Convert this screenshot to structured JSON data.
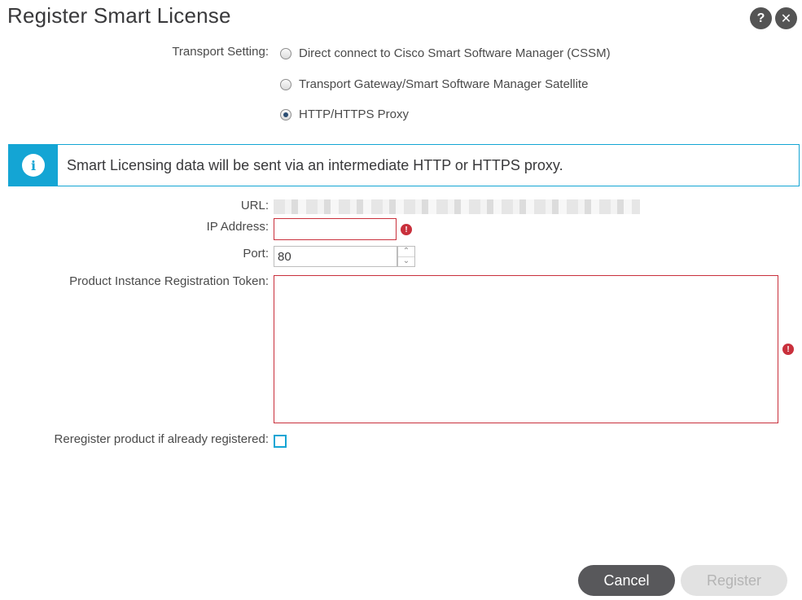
{
  "dialog": {
    "title": "Register Smart License",
    "help_label": "?",
    "close_label": "✕"
  },
  "transport": {
    "label": "Transport Setting:",
    "options": [
      {
        "label": "Direct connect to Cisco Smart Software Manager (CSSM)",
        "checked": false
      },
      {
        "label": "Transport Gateway/Smart Software Manager Satellite",
        "checked": false
      },
      {
        "label": "HTTP/HTTPS Proxy",
        "checked": true
      }
    ]
  },
  "info": {
    "icon": "info-icon",
    "glyph": "i",
    "message": "Smart Licensing data will be sent via an intermediate HTTP or HTTPS proxy."
  },
  "form": {
    "url_label": "URL:",
    "ip_label": "IP Address:",
    "ip_value": "",
    "port_label": "Port:",
    "port_value": "80",
    "token_label": "Product Instance Registration Token:",
    "token_value": "",
    "reregister_label": "Reregister product if already registered:",
    "reregister_checked": false,
    "error_glyph": "!"
  },
  "buttons": {
    "cancel": "Cancel",
    "register": "Register"
  },
  "colors": {
    "accent": "#14a5d4",
    "error": "#c9303c",
    "primary_button": "#58585b",
    "disabled_button": "#e2e2e2"
  }
}
